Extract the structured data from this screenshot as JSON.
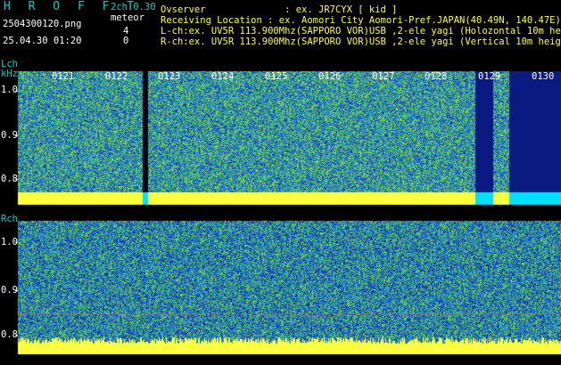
{
  "header": {
    "app_title": "H R O F F T",
    "mode": "2ch 0.30",
    "mode_suffix": "meteor",
    "filename": "2504300120.png",
    "count_lch": "4",
    "count_rch": "0",
    "datetime": "25.04.30 01:20",
    "observer_line": "Ovserver              : ex. JR7CYX [ kid ]",
    "location_line": "Receiving Location : ex. Aomori City Aomori-Pref.JAPAN(40.49N, 140.47E)",
    "lch_line": "L-ch:ex. UV5R 113.900Mhz(SAPPORO VOR)USB ,2-ele yagi (Holozontal 10m height)",
    "rch_line": "R-ch:ex. UV5R 113.900Mhz(SAPPORO VOR)USB ,2-ele yagi (Vertical 10m height)"
  },
  "lch": {
    "label": "Lch",
    "unit": "kHz",
    "y_ticks": [
      "1.0",
      "0.9",
      "0.8"
    ],
    "time_ticks": [
      "0121",
      "0122",
      "0123",
      "0124",
      "0125",
      "0126",
      "0127",
      "0128",
      "0129",
      "0130"
    ]
  },
  "rch": {
    "label": "Rch",
    "y_ticks": [
      "1.0",
      "0.9",
      "0.8"
    ]
  },
  "colors": {
    "teal": "#00d0c8",
    "yellow": "#ffff40",
    "cyan_band": "#00e0ff",
    "blue_bg": "#1040c0",
    "dark_blue": "#0a1a80"
  }
}
